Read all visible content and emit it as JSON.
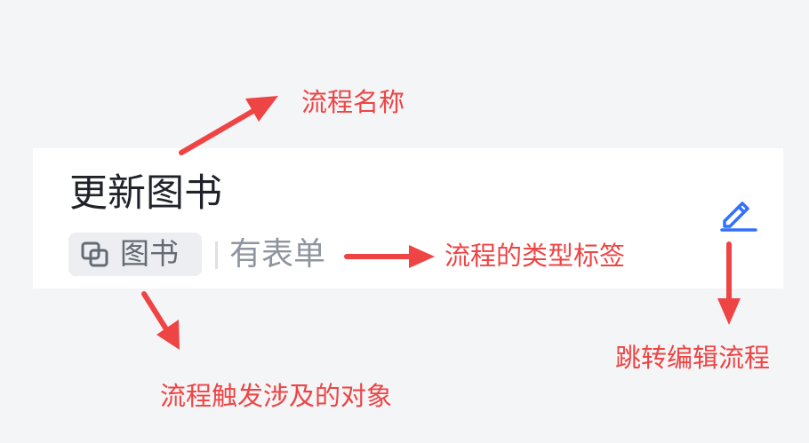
{
  "card": {
    "flow_name": "更新图书",
    "object_tag": {
      "icon": "relation-link-icon",
      "label": "图书"
    },
    "type_label": "有表单",
    "edit_icon": "pencil-edit-icon"
  },
  "annotations": {
    "flow_name": "流程名称",
    "flow_type": "流程的类型标签",
    "trigger_object": "流程触发涉及的对象",
    "edit_flow": "跳转编辑流程"
  },
  "colors": {
    "background": "#f4f5f7",
    "card": "#ffffff",
    "annotation": "#ee4444",
    "edit_icon": "#3370ff",
    "title_text": "#1f2329",
    "tag_background": "#eceef1"
  }
}
